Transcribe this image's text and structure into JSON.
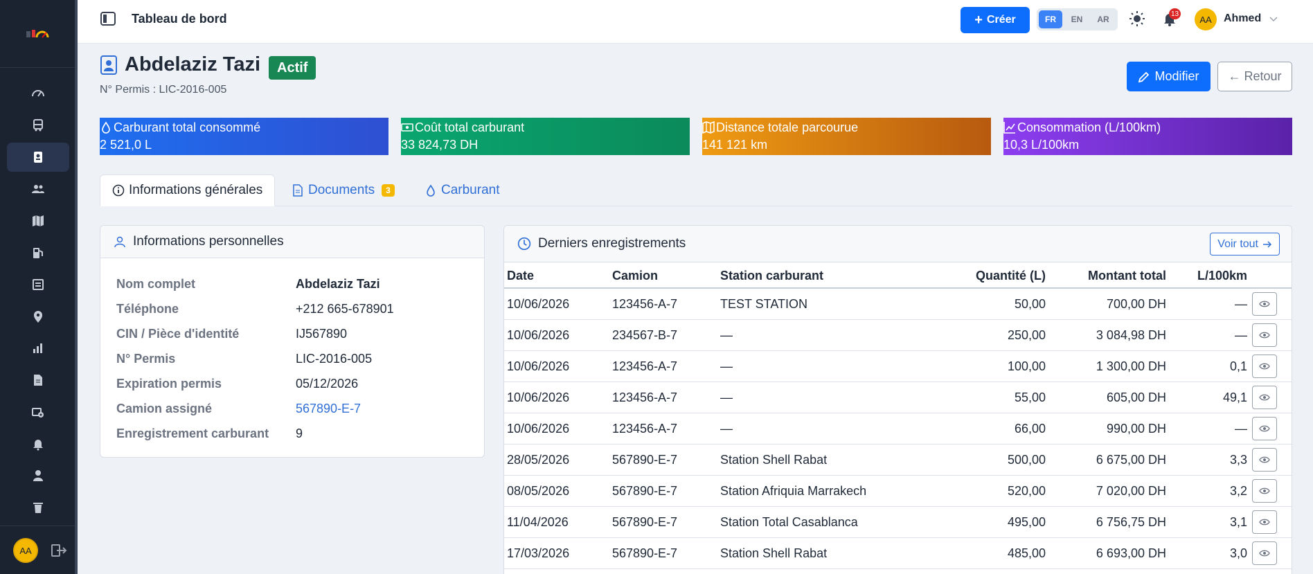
{
  "topbar": {
    "title": "Tableau de bord",
    "create_label": "Créer",
    "languages": [
      "FR",
      "EN",
      "AR"
    ],
    "active_language": "FR",
    "notification_count": "13",
    "user_initials": "AA",
    "user_name": "Ahmed"
  },
  "sidebar": {
    "items": [
      "dashboard-icon",
      "truck-icon",
      "driver-icon",
      "users-icon",
      "map-icon",
      "fuel-icon",
      "list-icon",
      "location-icon",
      "chart-icon",
      "document-icon",
      "maintenance-icon",
      "bell-icon",
      "person-icon",
      "trash-icon"
    ],
    "active_index": 2,
    "user_initials": "AA"
  },
  "driver": {
    "name": "Abdelaziz Tazi",
    "status": "Actif",
    "permit_line": "N° Permis : LIC-2016-005",
    "edit_label": "Modifier",
    "back_label": "← Retour"
  },
  "stats": [
    {
      "label": "Carburant total consommé",
      "value": "2 521,0 L",
      "icon": "drop-icon"
    },
    {
      "label": "Coût total carburant",
      "value": "33 824,73 DH",
      "icon": "cash-icon"
    },
    {
      "label": "Distance totale parcourue",
      "value": "141 121 km",
      "icon": "map-icon"
    },
    {
      "label": "Consommation (L/100km)",
      "value": "10,3 L/100km",
      "icon": "trend-icon"
    }
  ],
  "tabs": [
    {
      "label": "Informations générales",
      "active": true
    },
    {
      "label": "Documents",
      "count": "3"
    },
    {
      "label": "Carburant"
    }
  ],
  "personal": {
    "title": "Informations personnelles",
    "rows": [
      {
        "key": "Nom complet",
        "value": "Abdelaziz Tazi"
      },
      {
        "key": "Téléphone",
        "value": "+212 665-678901"
      },
      {
        "key": "CIN / Pièce d'identité",
        "value": "IJ567890"
      },
      {
        "key": "N° Permis",
        "value": "LIC-2016-005"
      },
      {
        "key": "Expiration permis",
        "value": "05/12/2026"
      },
      {
        "key": "Camion assigné",
        "value": "567890-E-7"
      },
      {
        "key": "Enregistrement carburant",
        "value": "9"
      }
    ]
  },
  "records": {
    "title": "Derniers enregistrements",
    "view_all_label": "Voir tout",
    "columns": [
      "Date",
      "Camion",
      "Station carburant",
      "Quantité (L)",
      "Montant total",
      "L/100km"
    ],
    "rows": [
      [
        "10/06/2026",
        "123456-A-7",
        "TEST STATION",
        "50,00",
        "700,00 DH",
        "—"
      ],
      [
        "10/06/2026",
        "234567-B-7",
        "—",
        "250,00",
        "3 084,98 DH",
        "—"
      ],
      [
        "10/06/2026",
        "123456-A-7",
        "—",
        "100,00",
        "1 300,00 DH",
        "0,1"
      ],
      [
        "10/06/2026",
        "123456-A-7",
        "—",
        "55,00",
        "605,00 DH",
        "49,1"
      ],
      [
        "10/06/2026",
        "123456-A-7",
        "—",
        "66,00",
        "990,00 DH",
        "—"
      ],
      [
        "28/05/2026",
        "567890-E-7",
        "Station Shell Rabat",
        "500,00",
        "6 675,00 DH",
        "3,3"
      ],
      [
        "08/05/2026",
        "567890-E-7",
        "Station Afriquia Marrakech",
        "520,00",
        "7 020,00 DH",
        "3,2"
      ],
      [
        "11/04/2026",
        "567890-E-7",
        "Station Total Casablanca",
        "495,00",
        "6 756,75 DH",
        "3,1"
      ],
      [
        "17/03/2026",
        "567890-E-7",
        "Station Shell Rabat",
        "485,00",
        "6 693,00 DH",
        "3,0"
      ]
    ]
  },
  "colors": {
    "primary": "#0d6efd",
    "success": "#198754",
    "sidebar_bg": "#1b2331",
    "badge_yellow": "#f5b800"
  }
}
